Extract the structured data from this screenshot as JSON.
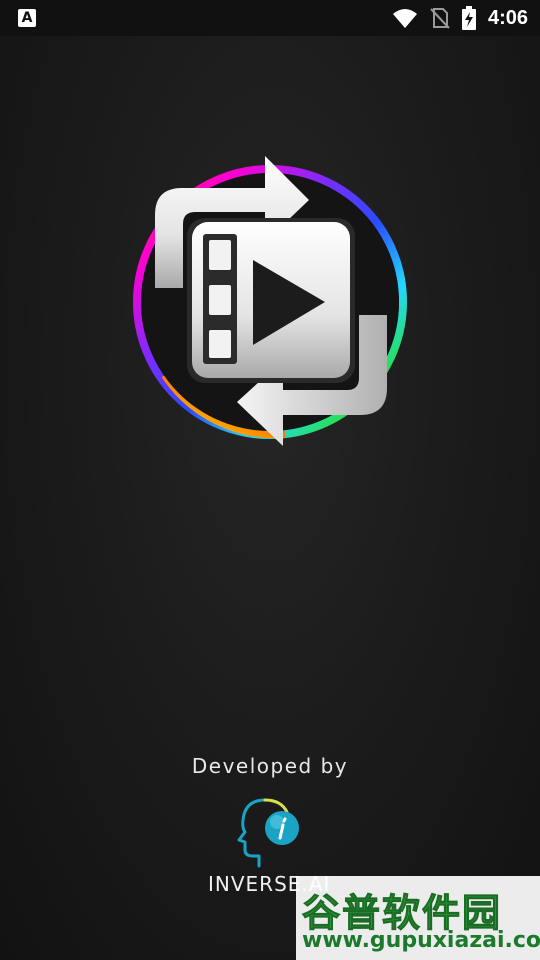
{
  "status_bar": {
    "app_icon_letter": "A",
    "time": "4:06",
    "icons": [
      "wifi-icon",
      "no-sim-icon",
      "battery-charging-icon"
    ]
  },
  "splash": {
    "app_logo": "video-convert-logo",
    "developed_by_label": "Developed by",
    "developer_name": "INVERSE.AI"
  },
  "watermark": {
    "chinese_text": "谷普软件园",
    "url": "www.gupuxiazai.com"
  },
  "colors": {
    "background": "#1c1c1c",
    "status_bar": "#111111",
    "brand_teal": "#1ba3c6",
    "watermark_green": "#2e9e3a"
  }
}
